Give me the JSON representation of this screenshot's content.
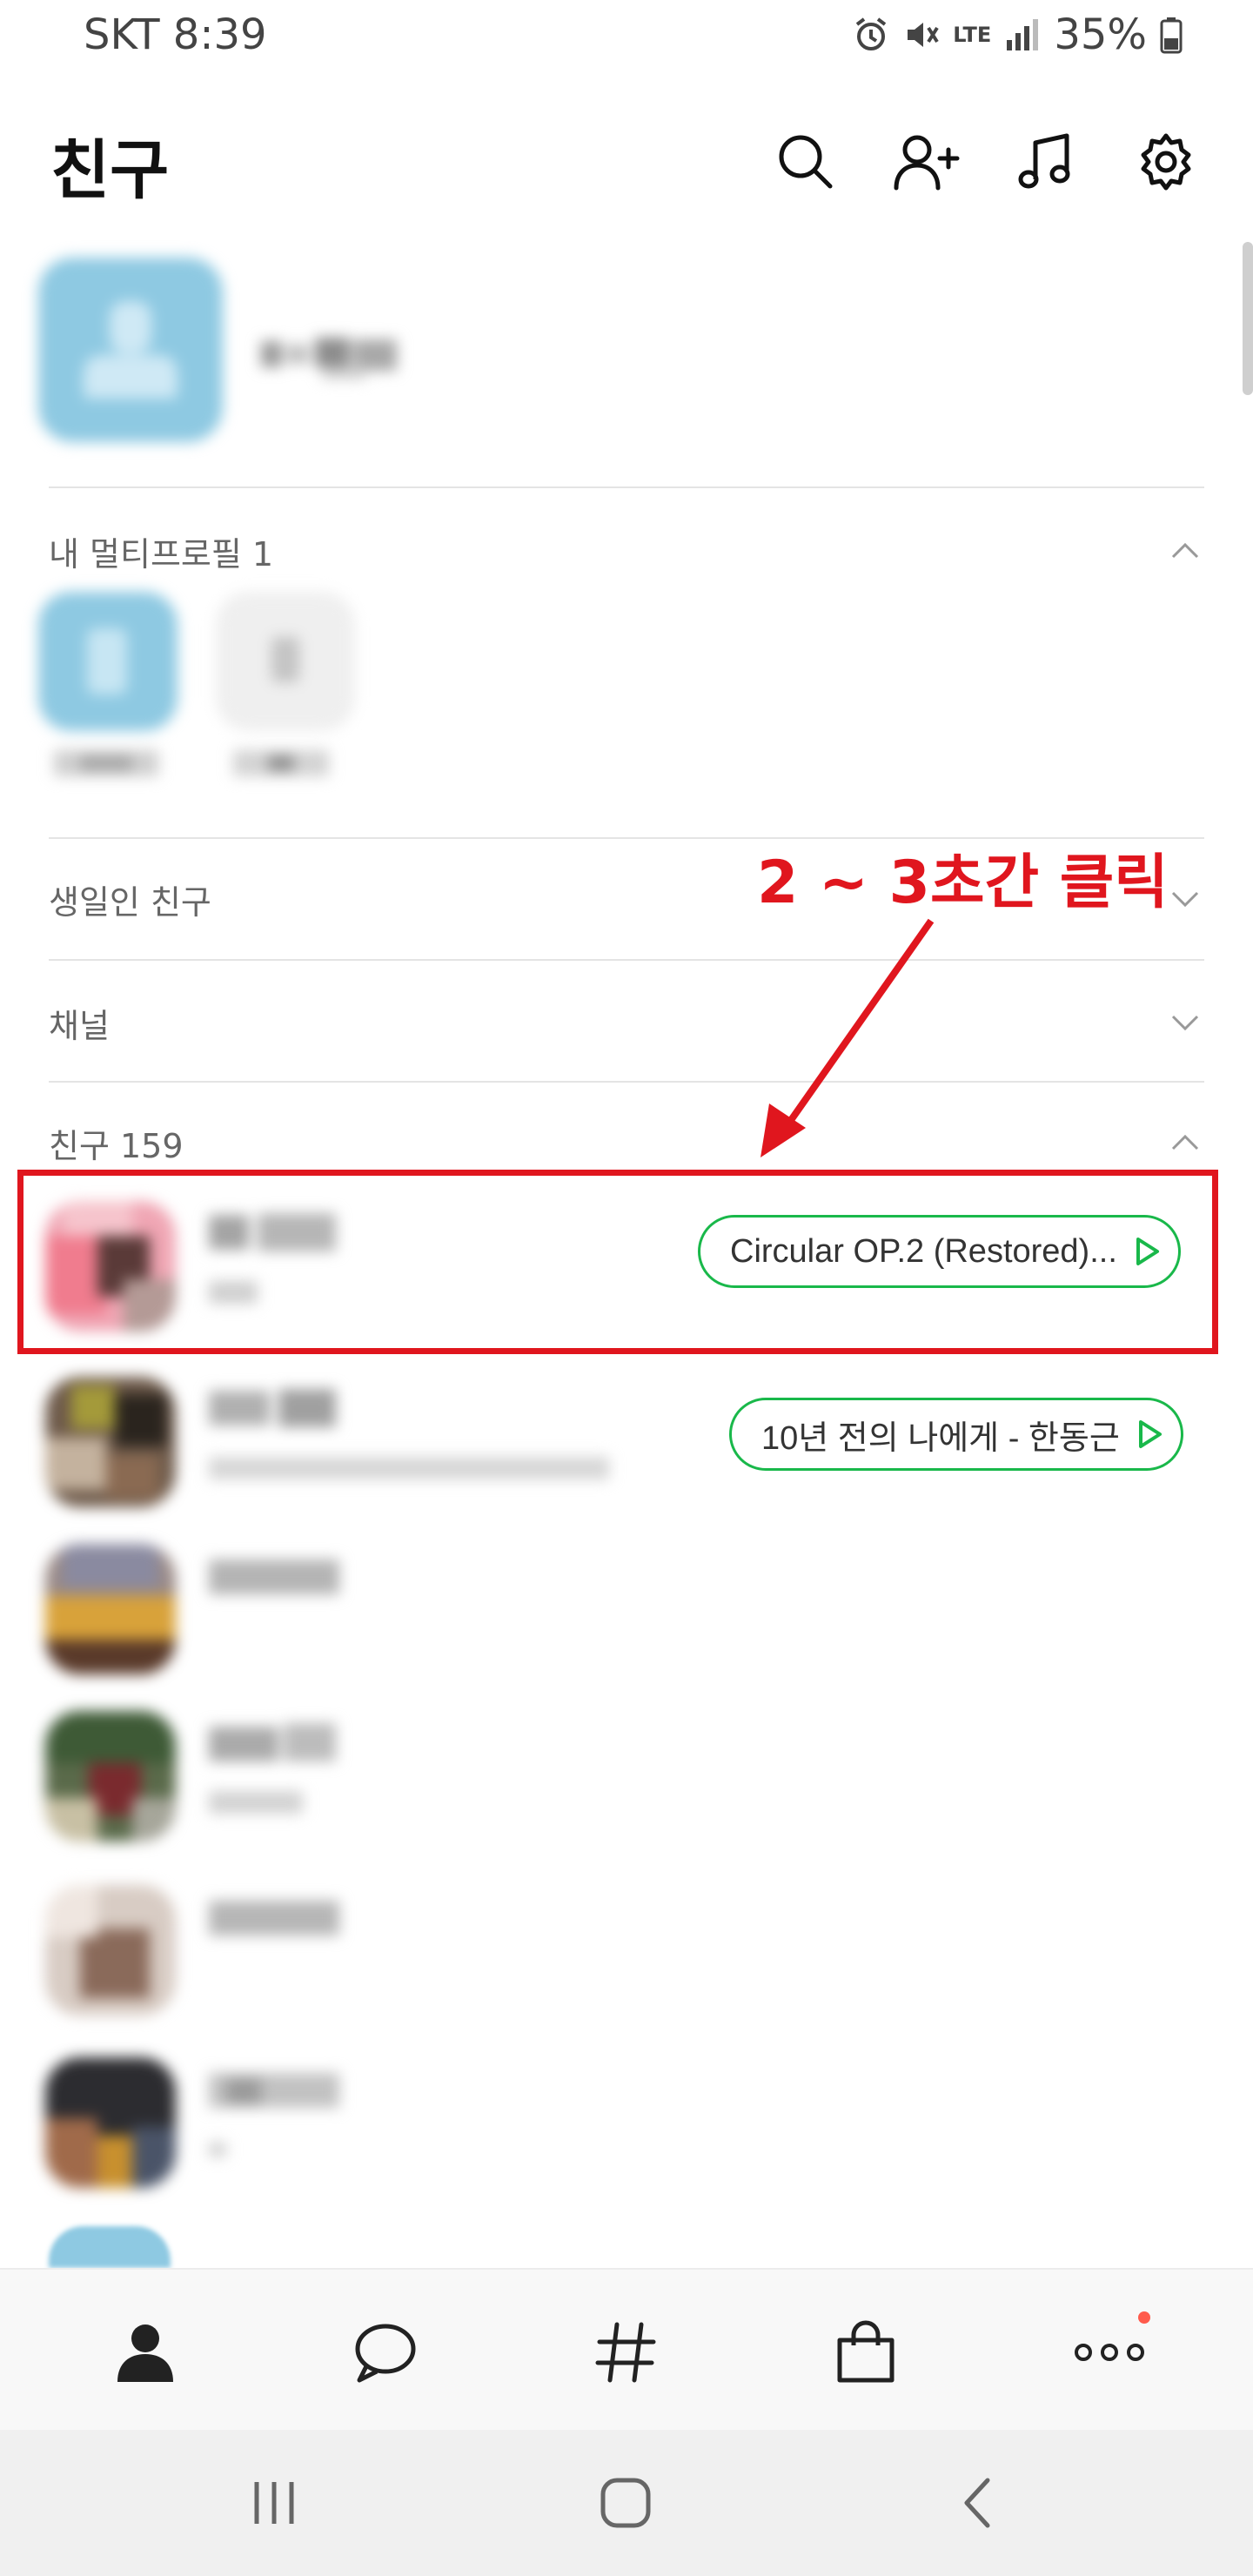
{
  "status_bar": {
    "carrier_time": "SKT 8:39",
    "network": "LTE",
    "battery": "35%"
  },
  "header": {
    "title": "친구",
    "icons": [
      "search-icon",
      "add-friend-icon",
      "music-note-icon",
      "settings-gear-icon"
    ]
  },
  "sections": {
    "multi_profile": "내 멀티프로필 1",
    "birthday_friends": "생일인 친구",
    "channels": "채널",
    "friends": "친구 159"
  },
  "friends": [
    {
      "music": "Circular OP.2 (Restored)..."
    },
    {
      "music": "10년 전의 나에게 - 한동근"
    },
    {},
    {},
    {},
    {}
  ],
  "annotation": "2 ~ 3초간 클릭",
  "colors": {
    "accent_green": "#19b84a",
    "annotation_red": "#e0161e",
    "badge_red": "#ff5b4c"
  },
  "tab_bar": [
    "friends-tab-icon",
    "chat-tab-icon",
    "hashtag-tab-icon",
    "shopping-bag-tab-icon",
    "more-tab-icon"
  ],
  "nav_bar": [
    "recents-icon",
    "home-icon",
    "back-icon"
  ]
}
